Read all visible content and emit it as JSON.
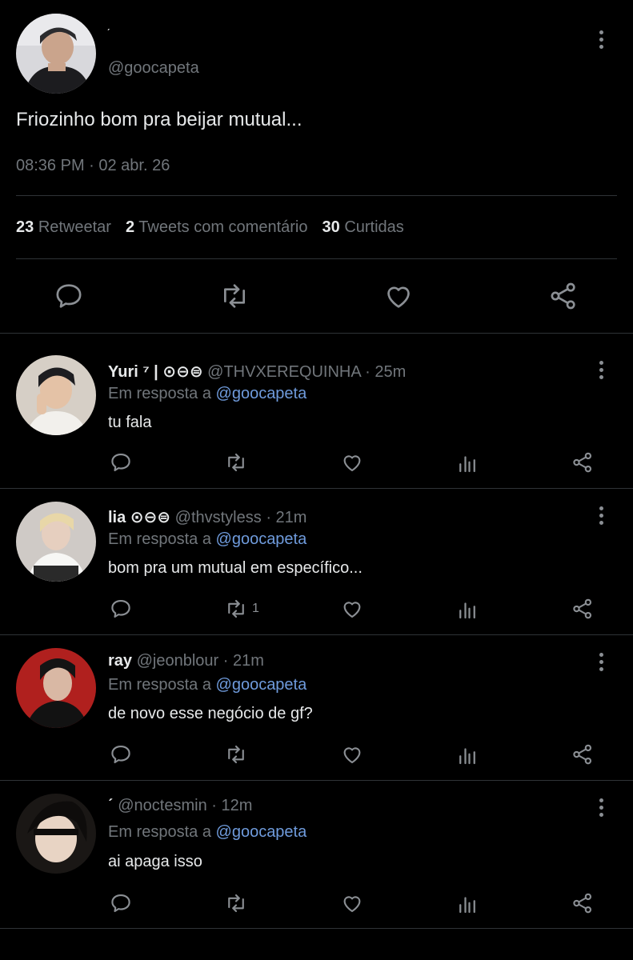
{
  "tweet": {
    "display_name": "ˏ",
    "handle": "@goocapeta",
    "text": "Friozinho bom pra beijar mutual...",
    "timestamp": "08:36 PM · 02 abr. 26",
    "stats": {
      "retweets_count": "23",
      "retweets_label": "Retweetar",
      "quotes_count": "2",
      "quotes_label": "Tweets com comentário",
      "likes_count": "30",
      "likes_label": "Curtidas"
    }
  },
  "replies": [
    {
      "name": "Yuri ⁷ | ⊙⊖⊜",
      "handle": "@THVXEREQUINHA",
      "time": "· 25m",
      "reply_prefix": "Em resposta a",
      "reply_to": "@goocapeta",
      "text": "tu fala",
      "retweet_count": ""
    },
    {
      "name": "lia ⊙⊖⊜",
      "handle": "@thvstyless",
      "time": "· 21m",
      "reply_prefix": "Em resposta a",
      "reply_to": "@goocapeta",
      "text": "bom pra um mutual em específico...",
      "retweet_count": "1"
    },
    {
      "name": "ray",
      "handle": "@jeonblour",
      "time": "· 21m",
      "reply_prefix": "Em resposta a",
      "reply_to": "@goocapeta",
      "text": "de novo esse negócio de gf?",
      "retweet_count": ""
    },
    {
      "name": "ˊ",
      "handle": "@noctesmin",
      "time": "· 12m",
      "reply_prefix": "Em resposta a",
      "reply_to": "@goocapeta",
      "text": "ai apaga isso",
      "retweet_count": ""
    }
  ],
  "colors": {
    "background": "#000000",
    "text": "#e7e9ea",
    "muted": "#71767b",
    "link": "#6f9bdc",
    "divider": "#2f3336"
  },
  "icons": [
    "reply-icon",
    "retweet-icon",
    "like-icon",
    "share-icon",
    "analytics-icon",
    "more-icon"
  ]
}
